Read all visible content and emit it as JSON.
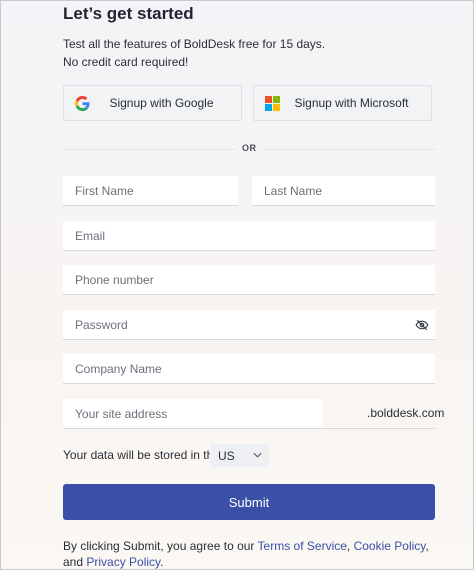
{
  "header": {
    "title": "Let’s get started",
    "subtitle_line1": "Test all the features of BoldDesk free for 15 days.",
    "subtitle_line2": "No credit card required!"
  },
  "sso": {
    "google_label": "Signup with Google",
    "microsoft_label": "Signup with Microsoft"
  },
  "divider": {
    "text": "OR"
  },
  "form": {
    "first_name_placeholder": "First Name",
    "last_name_placeholder": "Last Name",
    "email_placeholder": "Email",
    "phone_placeholder": "Phone number",
    "password_placeholder": "Password",
    "company_placeholder": "Company Name",
    "site_placeholder": "Your site address",
    "domain_suffix": ".bolddesk.com",
    "storage_text": "Your data will be stored in the",
    "region_value": "US",
    "submit_label": "Submit"
  },
  "legal": {
    "prefix": "By clicking Submit, you agree to our ",
    "terms_link": "Terms of Service",
    "separator": ", ",
    "cookie_link": "Cookie Policy",
    "comma": ",",
    "and_text": "and ",
    "privacy_link": "Privacy Policy",
    "period": "."
  },
  "colors": {
    "primary": "#3a4fa8",
    "google_blue": "#4285F4",
    "google_red": "#EA4335",
    "google_yellow": "#FBBC05",
    "google_green": "#34A853",
    "ms_red": "#F25022",
    "ms_green": "#7FBA00",
    "ms_blue": "#00A4EF",
    "ms_yellow": "#FFB900"
  },
  "icons": {
    "google": "google-logo-icon",
    "microsoft": "microsoft-logo-icon",
    "password_toggle": "eye-slash-icon",
    "dropdown": "chevron-down-icon"
  }
}
